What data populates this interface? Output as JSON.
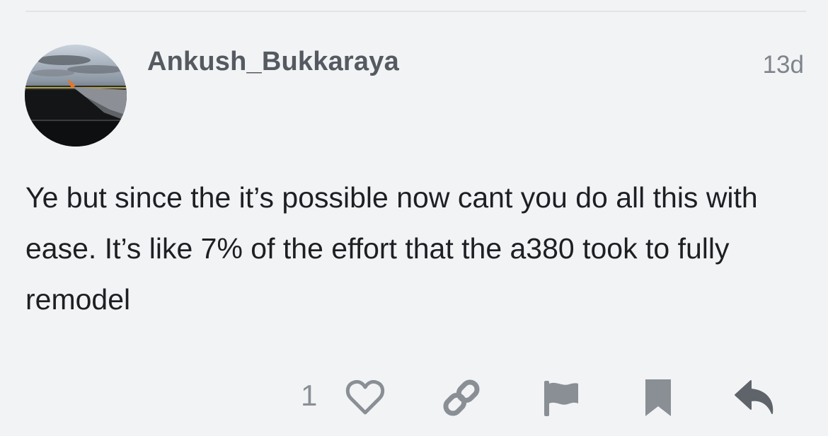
{
  "post": {
    "username": "Ankush_Bukkaraya",
    "date": "13d",
    "body": "Ye but since the it’s possible now cant you do all this with ease. It’s like 7% of the effort that the a380 took to fully remodel"
  },
  "actions": {
    "like_count": "1",
    "buttons": [
      {
        "name": "like",
        "icon": "heart-icon"
      },
      {
        "name": "copy-link",
        "icon": "link-icon"
      },
      {
        "name": "flag",
        "icon": "flag-icon"
      },
      {
        "name": "bookmark",
        "icon": "bookmark-icon"
      },
      {
        "name": "reply",
        "icon": "reply-icon"
      }
    ]
  },
  "colors": {
    "background": "#f2f3f5",
    "username": "#555a61",
    "date": "#7f848b",
    "body_text": "#1d1f22",
    "action_icon": "#8a8f96",
    "reply_icon": "#5f646b"
  }
}
